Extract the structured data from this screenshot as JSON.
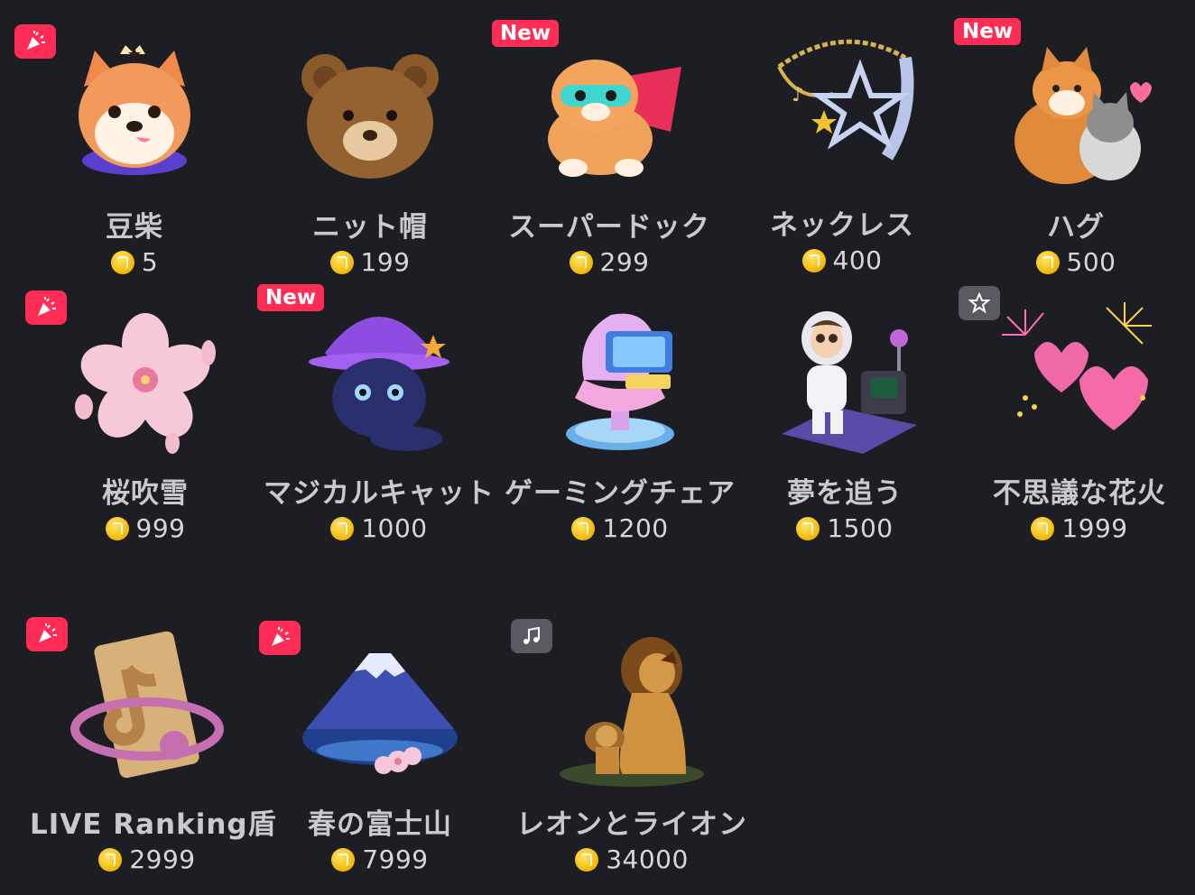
{
  "gifts": [
    {
      "name": "豆柴",
      "price": "5",
      "badge": "party",
      "art": "shiba-head"
    },
    {
      "name": "ニット帽",
      "price": "199",
      "badge": "",
      "art": "knit-bear"
    },
    {
      "name": "スーパードック",
      "price": "299",
      "badge": "New",
      "art": "super-dog"
    },
    {
      "name": "ネックレス",
      "price": "400",
      "badge": "",
      "art": "necklace"
    },
    {
      "name": "ハグ",
      "price": "500",
      "badge": "New",
      "art": "hug"
    },
    {
      "name": "桜吹雪",
      "price": "999",
      "badge": "party",
      "art": "sakura"
    },
    {
      "name": "マジカルキャット",
      "price": "1000",
      "badge": "New",
      "art": "magic-cat"
    },
    {
      "name": "ゲーミングチェア",
      "price": "1200",
      "badge": "",
      "art": "gaming-chair"
    },
    {
      "name": "夢を追う",
      "price": "1500",
      "badge": "",
      "art": "astronaut"
    },
    {
      "name": "不思議な花火",
      "price": "1999",
      "badge": "star",
      "art": "fireworks"
    },
    {
      "name": "LIVE Ranking盾",
      "price": "2999",
      "badge": "party",
      "art": "ranking-shield"
    },
    {
      "name": "春の富士山",
      "price": "7999",
      "badge": "party",
      "art": "fuji"
    },
    {
      "name": "レオンとライオン",
      "price": "34000",
      "badge": "music",
      "art": "lion"
    }
  ]
}
